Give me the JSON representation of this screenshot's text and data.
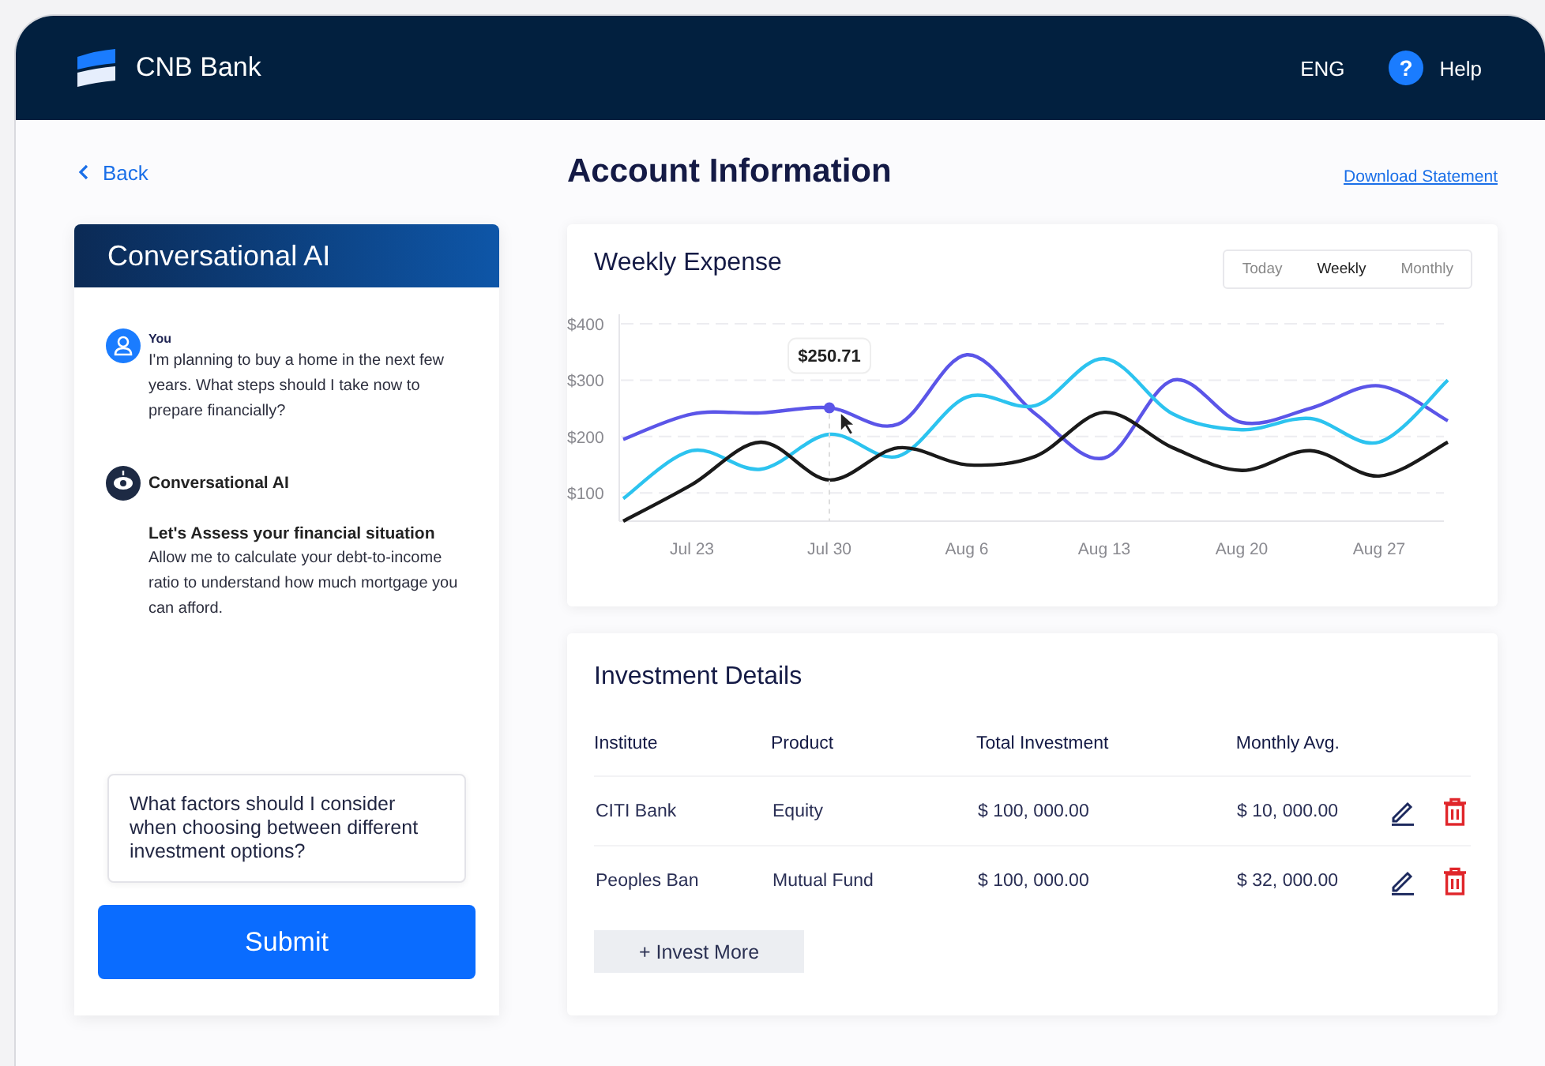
{
  "header": {
    "brand": "CNB Bank",
    "language": "ENG",
    "help_icon": "?",
    "help": "Help"
  },
  "back": "Back",
  "page_title": "Account Information",
  "download": "Download Statement",
  "chat": {
    "title": "Conversational AI",
    "messages": [
      {
        "kind": "user",
        "author": "You",
        "text": "I'm planning to buy a home in the next few years. What steps should I take now to prepare financially?"
      },
      {
        "kind": "bot",
        "author": "Conversational AI",
        "heading": "Let's Assess your financial situation",
        "text": "Allow me to calculate your debt-to-income ratio to understand how much mortgage you can afford."
      }
    ],
    "input": "What factors should I consider when choosing between different investment options?",
    "submit": "Submit"
  },
  "expense": {
    "title": "Weekly Expense",
    "tabs": [
      {
        "label": "Today",
        "selected": false
      },
      {
        "label": "Weekly",
        "selected": true
      },
      {
        "label": "Monthly",
        "selected": false
      }
    ],
    "chart_data": {
      "type": "line",
      "categories": [
        null,
        "Jul 23",
        null,
        "Jul 30",
        null,
        "Aug 6",
        null,
        "Aug 13",
        null,
        "Aug 20",
        null,
        "Aug 27",
        null
      ],
      "ylim": [
        50,
        400
      ],
      "yticks": [
        {
          "value": 100,
          "label": "$100"
        },
        {
          "value": 200,
          "label": "$200"
        },
        {
          "value": 300,
          "label": "$300"
        },
        {
          "value": 400,
          "label": "$400"
        }
      ],
      "series": [
        {
          "color": "#5b55e8",
          "values": [
            195,
            240,
            242,
            251,
            222,
            345,
            240,
            162,
            300,
            225,
            250,
            290,
            228
          ]
        },
        {
          "color": "#2cc3ef",
          "values": [
            90,
            175,
            142,
            204,
            165,
            270,
            255,
            338,
            240,
            212,
            232,
            190,
            300
          ]
        },
        {
          "color": "#1a1a1a",
          "values": [
            50,
            115,
            190,
            123,
            180,
            150,
            165,
            243,
            180,
            140,
            175,
            130,
            190
          ]
        }
      ],
      "grid": true,
      "annotations": [
        {
          "x": "Jul 30",
          "y": 251,
          "text": "$250.71"
        }
      ]
    }
  },
  "investments": {
    "title": "Investment Details",
    "columns": [
      "Institute",
      "Product",
      "Total Investment",
      "Monthly Avg."
    ],
    "rows": [
      [
        "CITI Bank",
        "Equity",
        "$ 100, 000.00",
        "$ 10, 000.00"
      ],
      [
        "Peoples Ban",
        "Mutual Fund",
        "$ 100, 000.00",
        "$ 32, 000.00"
      ]
    ],
    "add": "+ Invest More"
  }
}
